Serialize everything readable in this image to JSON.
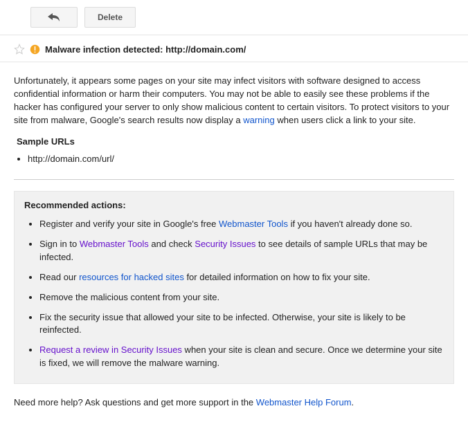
{
  "toolbar": {
    "delete_label": "Delete"
  },
  "header": {
    "title": "Malware infection detected: http://domain.com/"
  },
  "body": {
    "intro_pre": "Unfortunately, it appears some pages on your site may infect visitors with software designed to access confidential information or harm their computers. You may not be able to easily see these problems if the hacker has configured your server to only show malicious content to certain visitors. To protect visitors to your site from malware, Google's search results now display a ",
    "warning_link": "warning",
    "intro_post": " when users click a link to your site.",
    "sample_urls_label": "Sample URLs",
    "sample_urls": [
      "http://domain.com/url/"
    ]
  },
  "rec": {
    "title": "Recommended actions:",
    "items": [
      {
        "pre": "Register and verify your site in Google's free ",
        "link": "Webmaster Tools",
        "post": " if you haven't already done so."
      },
      {
        "pre": "Sign in to ",
        "link": "Webmaster Tools",
        "mid": " and check ",
        "link2": "Security Issues",
        "post": " to see details of sample URLs that may be infected."
      },
      {
        "pre": "Read our ",
        "link": "resources for hacked sites",
        "post": " for detailed information on how to fix your site."
      },
      {
        "pre": "Remove the malicious content from your site."
      },
      {
        "pre": "Fix the security issue that allowed your site to be infected. Otherwise, your site is likely to be reinfected."
      },
      {
        "link": "Request a review in Security Issues",
        "post": " when your site is clean and secure. Once we determine your site is fixed, we will remove the malware warning."
      }
    ]
  },
  "footer": {
    "pre": "Need more help? Ask questions and get more support in the ",
    "link": "Webmaster Help Forum",
    "post": "."
  }
}
